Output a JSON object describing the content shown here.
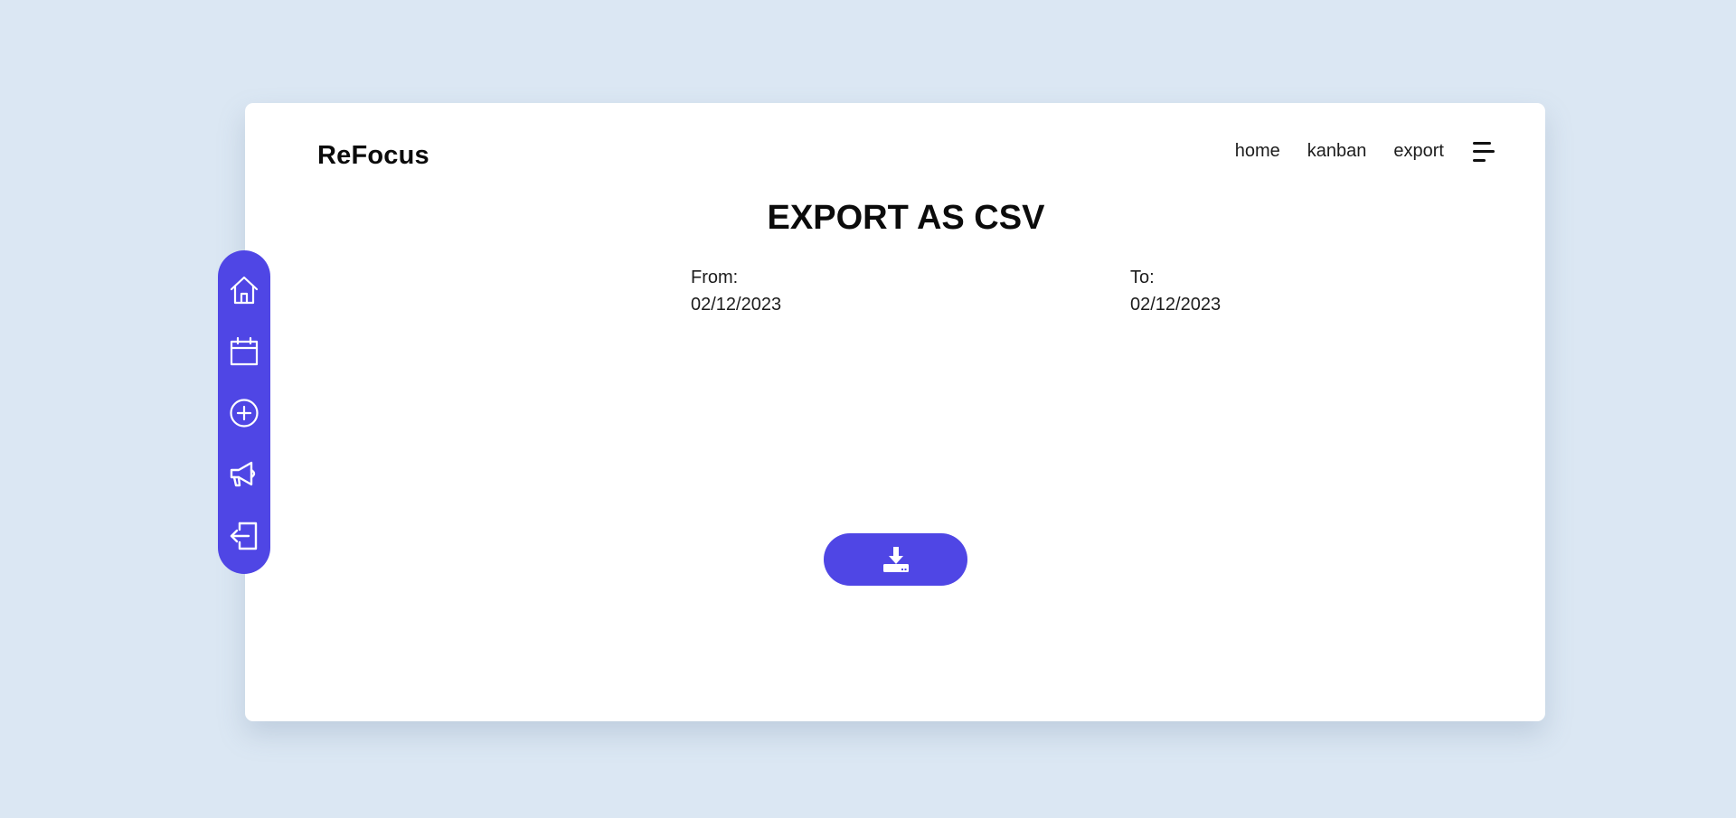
{
  "app": {
    "brand": "ReFocus"
  },
  "nav": {
    "links": [
      "home",
      "kanban",
      "export"
    ],
    "menu_icon": "menu-icon"
  },
  "sidebar": {
    "items": [
      {
        "icon": "home-icon"
      },
      {
        "icon": "calendar-icon"
      },
      {
        "icon": "add-circle-icon"
      },
      {
        "icon": "megaphone-icon"
      },
      {
        "icon": "logout-icon"
      }
    ]
  },
  "main": {
    "title": "EXPORT AS CSV",
    "from": {
      "label": "From:",
      "value": "02/12/2023"
    },
    "to": {
      "label": "To:",
      "value": "02/12/2023"
    },
    "download_icon": "download-icon"
  },
  "colors": {
    "background": "#dbe7f3",
    "accent": "#4f46e5",
    "card": "#ffffff"
  }
}
